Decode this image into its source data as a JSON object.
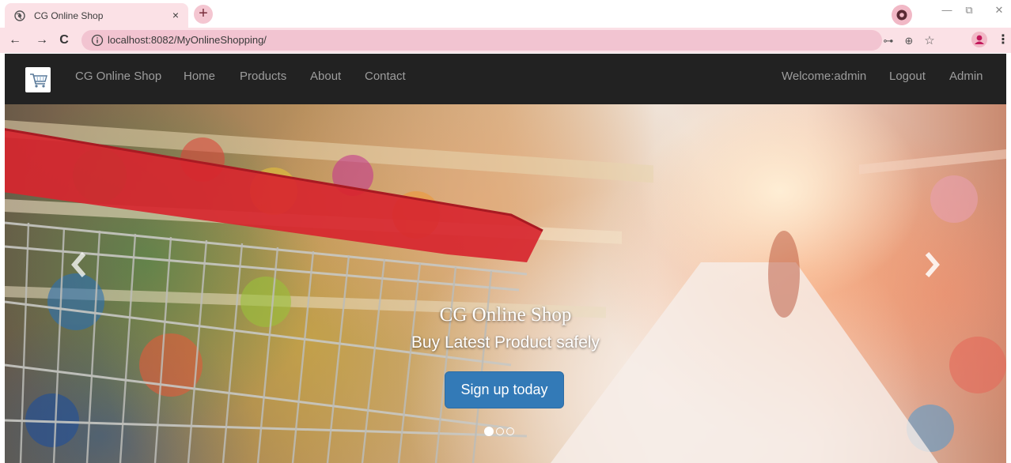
{
  "browser": {
    "tab": {
      "title": "CG Online Shop",
      "close_glyph": "×",
      "favicon": "globe-icon"
    },
    "new_tab_glyph": "+",
    "window_controls": {
      "minimize": "—",
      "restore": "⧉",
      "close": "✕"
    },
    "address_bar": {
      "url": "localhost:8082/MyOnlineShopping/"
    },
    "nav": {
      "back": "←",
      "forward": "→",
      "reload": "C"
    },
    "omnibox_icons": {
      "key": "⊶",
      "zoom": "⊕",
      "star": "☆"
    },
    "menu_glyph": "⋮"
  },
  "navbar": {
    "brand": "CG Online Shop",
    "links": [
      "Home",
      "Products",
      "About",
      "Contact"
    ],
    "right_links": [
      "Welcome:admin",
      "Logout",
      "Admin"
    ],
    "background": "#222222",
    "link_color": "#9d9d9d"
  },
  "hero": {
    "caption_title": "CG Online Shop",
    "caption_subtitle": "Buy Latest Product safely",
    "cta_label": "Sign up today",
    "cta_color": "#337ab7",
    "prev_icon": "chevron-left-icon",
    "next_icon": "chevron-right-icon",
    "indicators": {
      "count": 3,
      "active_index": 0
    }
  }
}
